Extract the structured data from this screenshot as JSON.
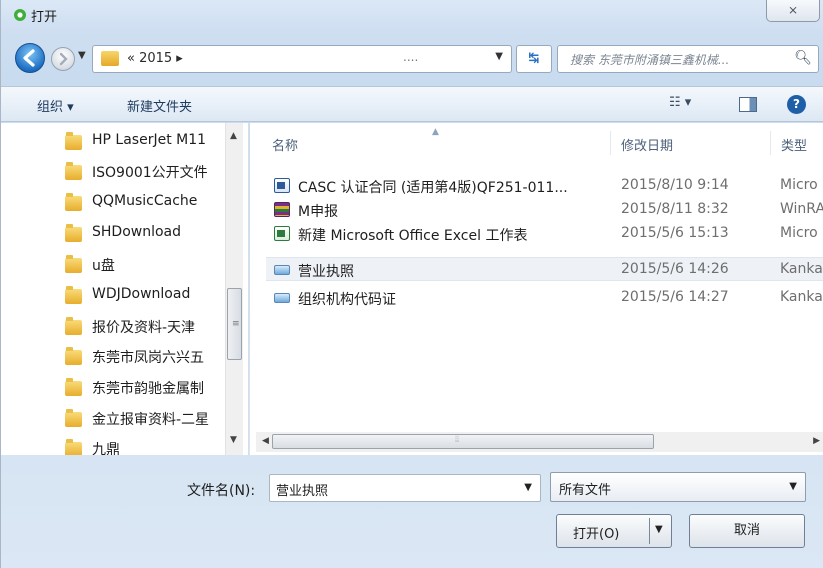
{
  "titlebar": {
    "title": "打开",
    "close_label": "⨯"
  },
  "address": {
    "text": "« 2015 ▸",
    "ellipsis": "....",
    "refresh_label": "↹",
    "search_placeholder": "搜索 东莞市附涌镇三鑫机械..."
  },
  "toolbar": {
    "organize_label": "组织 ▾",
    "new_folder_label": "新建文件夹",
    "view_label": "☷ ▾",
    "help_label": "?"
  },
  "nav": {
    "items": [
      {
        "label": "HP LaserJet M11"
      },
      {
        "label": "ISO9001公开文件"
      },
      {
        "label": "QQMusicCache"
      },
      {
        "label": "SHDownload"
      },
      {
        "label": "u盘"
      },
      {
        "label": "WDJDownload"
      },
      {
        "label": "报价及资料-天津"
      },
      {
        "label": "东莞市凤岗六兴五"
      },
      {
        "label": "东莞市韵驰金属制"
      },
      {
        "label": "金立报审资料-二星"
      },
      {
        "label": "九鼎"
      }
    ]
  },
  "columns": {
    "name": "名称",
    "date": "修改日期",
    "type": "类型"
  },
  "files": [
    {
      "name": "CASC 认证合同 (适用第4版)QF251-011...",
      "date": "2015/8/10 9:14",
      "type": "Micro",
      "icon": "word-doc-icon"
    },
    {
      "name": "M申报",
      "date": "2015/8/11 8:32",
      "type": "WinRA",
      "icon": "rar-archive-icon"
    },
    {
      "name": "新建 Microsoft Office Excel 工作表",
      "date": "2015/5/6 15:13",
      "type": "Micro",
      "icon": "excel-sheet-icon"
    },
    {
      "name": "营业执照",
      "date": "2015/5/6 14:26",
      "type": "Kanka",
      "icon": "image-file-icon"
    },
    {
      "name": "组织机构代码证",
      "date": "2015/5/6 14:27",
      "type": "Kanka",
      "icon": "image-file-icon"
    }
  ],
  "bottom": {
    "filename_label": "文件名(N):",
    "filename_value": "营业执照",
    "filter_value": "所有文件",
    "open_label": "打开(O)",
    "cancel_label": "取消"
  }
}
